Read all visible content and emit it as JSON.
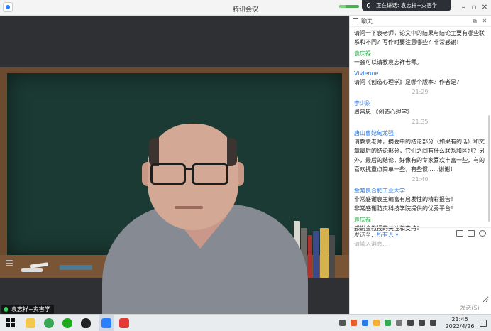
{
  "window": {
    "title": "腾讯会议",
    "speaking_banner": "正在讲话: 袁志祥+灾害学"
  },
  "video": {
    "participant_name": "袁志祥+灾害学"
  },
  "chat": {
    "title": "聊天",
    "messages": [
      {
        "sender": "",
        "text": "请问一下袁老师，论文中的结果与结论主要有哪些联系和不同？写作时要注意哪些？非常感谢！",
        "time": ""
      },
      {
        "sender": "袁庆禄",
        "sender_color": "#2db34a",
        "text": "一会可以请教袁志祥老师。",
        "time": ""
      },
      {
        "sender": "Vivienne",
        "sender_color": "#2d7ce6",
        "text": "请问《创造心理学》是哪个版本？作者是?",
        "time": "21:29"
      },
      {
        "sender": "宁少尉",
        "sender_color": "#2d7ce6",
        "text": "周昌忠 《创造心理学》",
        "time": "21:35"
      },
      {
        "sender": "唐山曹妃甸龙强",
        "sender_color": "#2d7ce6",
        "text": "请教袁老师，摘要中的结论部分（如果有的话）和文章最后的结论部分，它们之间有什么联系和区别？另外，最后的结论，好像有的专家喜欢丰富一些，有的喜欢挑重点简单一些，有些惯......谢谢！",
        "time": "21:40"
      },
      {
        "sender": "金菊良合肥工业大学",
        "sender_color": "#2d7ce6",
        "text": "非常感谢袁主编富有启发性的精彩报告！\n非常感谢防灾科技学院提供的优秀平台！",
        "time": ""
      },
      {
        "sender": "袁庆禄",
        "sender_color": "#2db34a",
        "text": "感谢金教授的关注和支持！",
        "time": ""
      }
    ],
    "send_to_label": "发送至:",
    "send_target": "所有人",
    "input_placeholder": "请输入消息...",
    "send_button": "发送(S)"
  },
  "taskbar": {
    "time": "21:46",
    "date": "2022/4/26"
  },
  "colors": {
    "accent": "#2d7ce6",
    "green_name": "#2db34a",
    "board": "#1b3a33"
  }
}
